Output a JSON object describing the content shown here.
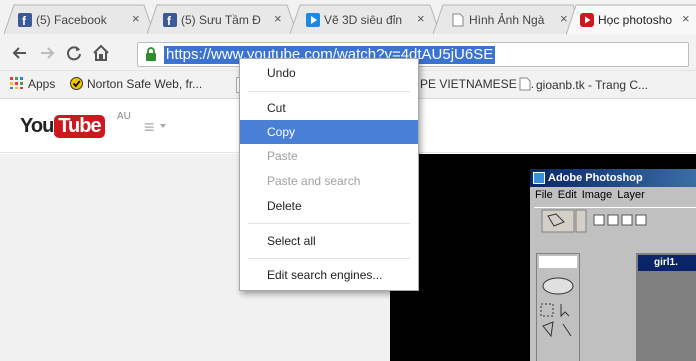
{
  "tabs": [
    {
      "title": "(5) Facebook",
      "favicon": "facebook-icon",
      "color": "#3b5998"
    },
    {
      "title": "(5) Sưu Tầm Đ",
      "favicon": "facebook-icon",
      "color": "#3b5998"
    },
    {
      "title": "Vẽ 3D siêu đỉn",
      "favicon": "play-icon",
      "color": "#1e88e5"
    },
    {
      "title": "Hình Ảnh Ngà",
      "favicon": "page-icon",
      "color": "#888888"
    },
    {
      "title": "Học photosho",
      "favicon": "youtube-icon",
      "color": "#cc181e"
    }
  ],
  "tab_close": "×",
  "toolbar": {
    "url": "https://www.youtube.com/watch?v=4dtAU5jU6SE"
  },
  "bookmarks": [
    {
      "label": "Apps"
    },
    {
      "label": "Norton Safe Web, fr..."
    },
    {
      "label": "PE VIETNAMESE -..."
    },
    {
      "label": "gioanb.tk - Trang C..."
    }
  ],
  "youtube": {
    "logo_you": "You",
    "logo_tube": "Tube",
    "region": "AU",
    "guide": "≡"
  },
  "photoshop": {
    "title": "Adobe Photoshop",
    "menu": [
      "File",
      "Edit",
      "Image",
      "Layer"
    ],
    "doc_title": "girl1."
  },
  "context_menu": {
    "items": [
      {
        "label": "Undo",
        "state": "normal"
      },
      {
        "label": "Cut",
        "state": "normal"
      },
      {
        "label": "Copy",
        "state": "highlighted"
      },
      {
        "label": "Paste",
        "state": "disabled"
      },
      {
        "label": "Paste and search",
        "state": "disabled"
      },
      {
        "label": "Delete",
        "state": "normal"
      },
      {
        "label": "Select all",
        "state": "normal"
      },
      {
        "label": "Edit search engines...",
        "state": "normal"
      }
    ]
  },
  "colors": {
    "selection": "#3b73d1",
    "menu_highlight": "#4a7fd6",
    "youtube_red": "#cc181e"
  }
}
